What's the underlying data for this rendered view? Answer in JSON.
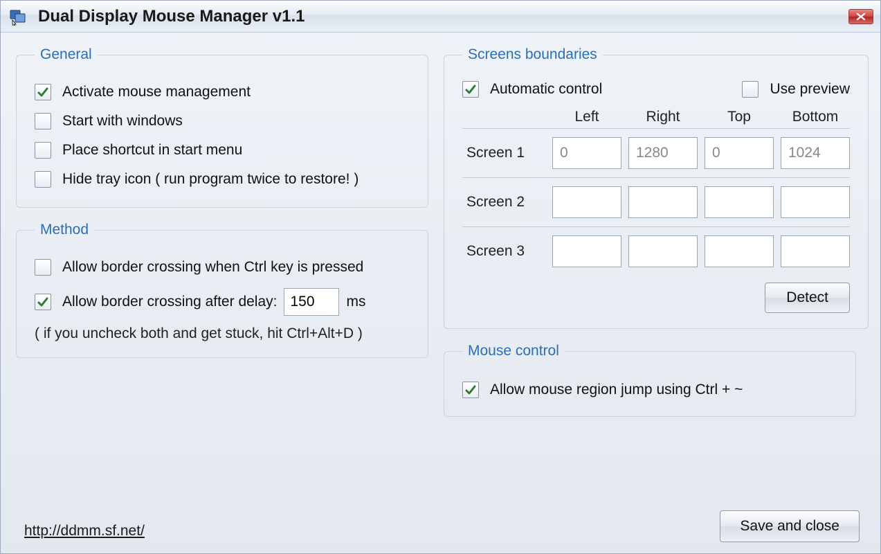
{
  "window": {
    "title": "Dual Display Mouse Manager v1.1"
  },
  "general": {
    "legend": "General",
    "items": {
      "activate": {
        "label": "Activate mouse management",
        "checked": true
      },
      "startwin": {
        "label": "Start with windows",
        "checked": false
      },
      "shortcut": {
        "label": "Place shortcut in start menu",
        "checked": false
      },
      "hidetray": {
        "label": "Hide tray icon ( run program twice to restore! )",
        "checked": false
      }
    }
  },
  "method": {
    "legend": "Method",
    "ctrl": {
      "label": "Allow border crossing when Ctrl key is pressed",
      "checked": false
    },
    "delay": {
      "prefix": "Allow border crossing after delay:",
      "value": "150",
      "suffix": "ms",
      "checked": true
    },
    "hint": "( if you uncheck both and get stuck, hit Ctrl+Alt+D )"
  },
  "bounds": {
    "legend": "Screens boundaries",
    "auto": {
      "label": "Automatic control",
      "checked": true
    },
    "preview": {
      "label": "Use preview",
      "checked": false
    },
    "headers": {
      "left": "Left",
      "right": "Right",
      "top": "Top",
      "bottom": "Bottom"
    },
    "screens": [
      {
        "name": "Screen 1",
        "left": "0",
        "right": "1280",
        "top": "0",
        "bottom": "1024"
      },
      {
        "name": "Screen 2",
        "left": "",
        "right": "",
        "top": "",
        "bottom": ""
      },
      {
        "name": "Screen 3",
        "left": "",
        "right": "",
        "top": "",
        "bottom": ""
      }
    ],
    "detect_label": "Detect"
  },
  "mouse_control": {
    "legend": "Mouse control",
    "jump": {
      "label": "Allow mouse region jump using Ctrl + ~",
      "checked": true
    }
  },
  "footer": {
    "link_text": "http://ddmm.sf.net/"
  },
  "save_label": "Save and close"
}
